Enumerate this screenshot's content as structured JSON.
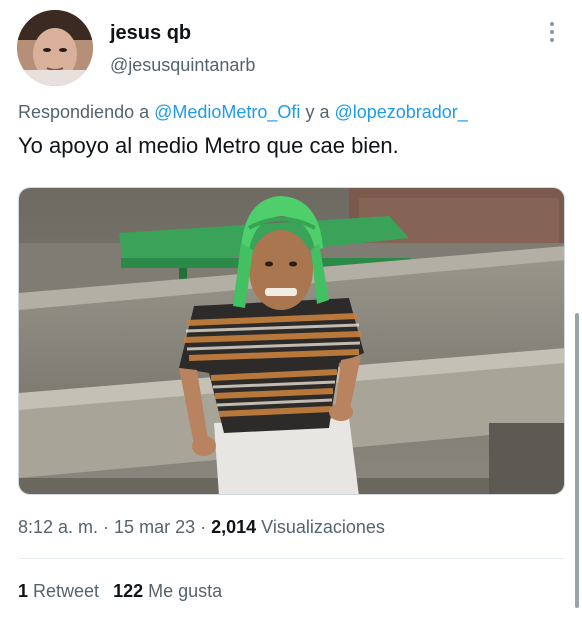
{
  "author": {
    "name": "jesus qb",
    "handle": "@jesusquintanarb"
  },
  "reply": {
    "prefix": "Respondiendo a ",
    "mention1": "@MedioMetro_Ofi",
    "connector": " y a ",
    "mention2": "@lopezobrador_"
  },
  "tweet": {
    "text": "Yo apoyo al medio Metro que cae bien."
  },
  "meta": {
    "time": "8:12 a. m.",
    "sep1": " · ",
    "date": "15 mar 23",
    "sep2": " · ",
    "views_count": "2,014",
    "views_label": " Visualizaciones"
  },
  "stats": {
    "retweets_count": "1",
    "retweets_label": " Retweet",
    "likes_count": "122",
    "likes_label": " Me gusta"
  },
  "icons": {
    "more": "more-vertical-icon"
  }
}
